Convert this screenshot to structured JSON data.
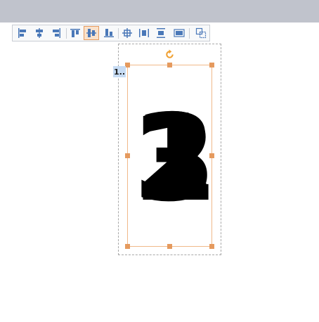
{
  "toolbar": {
    "buttons": [
      {
        "icon": "align-left-icon"
      },
      {
        "icon": "align-center-horizontal-icon"
      },
      {
        "icon": "align-right-icon"
      },
      {
        "icon": "align-top-icon"
      },
      {
        "icon": "align-middle-vertical-icon",
        "active": true
      },
      {
        "icon": "align-bottom-icon"
      },
      {
        "icon": "align-center-both-icon"
      },
      {
        "icon": "distribute-horizontal-icon"
      },
      {
        "icon": "distribute-vertical-icon"
      },
      {
        "icon": "stretch-icon"
      },
      {
        "icon": "group-objects-icon"
      }
    ]
  },
  "canvas": {
    "badge_label": "1..",
    "shapes": [
      {
        "text": "1"
      },
      {
        "text": "2"
      },
      {
        "text": "3"
      }
    ]
  },
  "colors": {
    "accent": "#e59a5e",
    "icon": "#4a78b8",
    "topbar": "#c0c3cc",
    "badge": "#c7dcf4"
  }
}
